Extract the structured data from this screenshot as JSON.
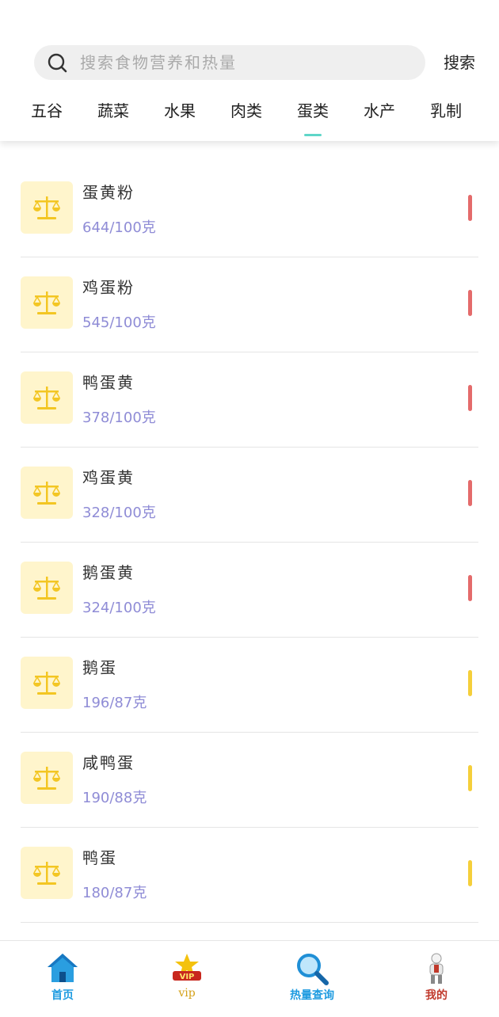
{
  "search": {
    "placeholder": "搜索食物营养和热量",
    "button_label": "搜索"
  },
  "tabs": [
    {
      "label": "五谷",
      "active": false
    },
    {
      "label": "蔬菜",
      "active": false
    },
    {
      "label": "水果",
      "active": false
    },
    {
      "label": "肉类",
      "active": false
    },
    {
      "label": "蛋类",
      "active": true
    },
    {
      "label": "水产",
      "active": false
    },
    {
      "label": "乳制",
      "active": false
    }
  ],
  "foods": [
    {
      "name": "蛋黄粉",
      "calorie": "644/100克",
      "level": "high"
    },
    {
      "name": "鸡蛋粉",
      "calorie": "545/100克",
      "level": "high"
    },
    {
      "name": "鸭蛋黄",
      "calorie": "378/100克",
      "level": "high"
    },
    {
      "name": "鸡蛋黄",
      "calorie": "328/100克",
      "level": "high"
    },
    {
      "name": "鹅蛋黄",
      "calorie": "324/100克",
      "level": "high"
    },
    {
      "name": "鹅蛋",
      "calorie": "196/87克",
      "level": "medium"
    },
    {
      "name": "咸鸭蛋",
      "calorie": "190/88克",
      "level": "medium"
    },
    {
      "name": "鸭蛋",
      "calorie": "180/87克",
      "level": "medium"
    }
  ],
  "level_colors": {
    "high": "#e46b6b",
    "medium": "#f5cf3b"
  },
  "bottom_nav": [
    {
      "label": "首页",
      "icon": "home-icon",
      "color": "#1e9be0"
    },
    {
      "label": "vip",
      "icon": "vip-crown-icon",
      "color": "#d4a017"
    },
    {
      "label": "热量查询",
      "icon": "magnifier-icon",
      "color": "#1e9be0"
    },
    {
      "label": "我的",
      "icon": "person-icon",
      "color": "#c0392b"
    }
  ]
}
